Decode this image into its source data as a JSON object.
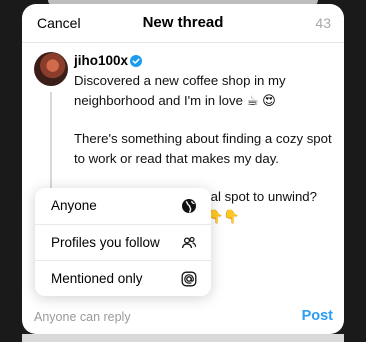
{
  "header": {
    "cancel_label": "Cancel",
    "title": "New thread",
    "char_count": "43"
  },
  "post": {
    "username": "jiho100x",
    "verified_icon": "verified-badge-icon",
    "paragraphs": [
      "Discovered a new coffee shop in my neighborhood and I'm in love ☕ 😍",
      "There's something about finding a cozy spot to work or read that makes my day.",
      "What's your favorite local spot to unwind? Let me know below 👇👇👇"
    ]
  },
  "reply_menu": {
    "items": [
      {
        "label": "Anyone",
        "icon": "globe-icon"
      },
      {
        "label": "Profiles you follow",
        "icon": "people-icon"
      },
      {
        "label": "Mentioned only",
        "icon": "at-sign-icon"
      }
    ]
  },
  "footer": {
    "reply_setting": "Anyone can reply",
    "post_label": "Post"
  },
  "colors": {
    "accent": "#2a9df4",
    "verified": "#1d9bf0",
    "muted": "#9a9a9a"
  }
}
